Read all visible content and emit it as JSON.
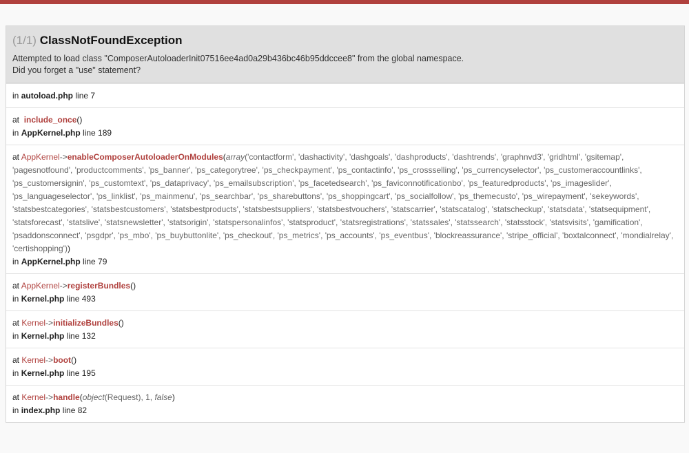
{
  "header": {
    "count": "(1/1)",
    "exception": "ClassNotFoundException",
    "message_line1": "Attempted to load class \"ComposerAutoloaderInit07516ee4ad0a29b436bc46b95ddccee8\" from the global namespace.",
    "message_line2": "Did you forget a \"use\" statement?"
  },
  "frames": [
    {
      "in": "in",
      "file": "autoload.php",
      "line": "line 7"
    },
    {
      "at": "at",
      "fn": "include_once",
      "paren_open": "(",
      "paren_close": ")",
      "in": "in",
      "file": "AppKernel.php",
      "line": "line 189"
    },
    {
      "at": "at",
      "cls": "AppKernel",
      "arrow": "->",
      "fn": "enableComposerAutoloaderOnModules",
      "paren_open": "(",
      "arg_type": "array",
      "args": "('contactform', 'dashactivity', 'dashgoals', 'dashproducts', 'dashtrends', 'graphnvd3', 'gridhtml', 'gsitemap', 'pagesnotfound', 'productcomments', 'ps_banner', 'ps_categorytree', 'ps_checkpayment', 'ps_contactinfo', 'ps_crossselling', 'ps_currencyselector', 'ps_customeraccountlinks', 'ps_customersignin', 'ps_customtext', 'ps_dataprivacy', 'ps_emailsubscription', 'ps_facetedsearch', 'ps_faviconnotificationbo', 'ps_featuredproducts', 'ps_imageslider', 'ps_languageselector', 'ps_linklist', 'ps_mainmenu', 'ps_searchbar', 'ps_sharebuttons', 'ps_shoppingcart', 'ps_socialfollow', 'ps_themecusto', 'ps_wirepayment', 'sekeywords', 'statsbestcategories', 'statsbestcustomers', 'statsbestproducts', 'statsbestsuppliers', 'statsbestvouchers', 'statscarrier', 'statscatalog', 'statscheckup', 'statsdata', 'statsequipment', 'statsforecast', 'statslive', 'statsnewsletter', 'statsorigin', 'statspersonalinfos', 'statsproduct', 'statsregistrations', 'statssales', 'statssearch', 'statsstock', 'statsvisits', 'gamification', 'psaddonsconnect', 'psgdpr', 'ps_mbo', 'ps_buybuttonlite', 'ps_checkout', 'ps_metrics', 'ps_accounts', 'ps_eventbus', 'blockreassurance', 'stripe_official', 'boxtalconnect', 'mondialrelay', 'certishopping')",
      "paren_close": ")",
      "in": "in",
      "file": "AppKernel.php",
      "line": "line 79"
    },
    {
      "at": "at",
      "cls": "AppKernel",
      "arrow": "->",
      "fn": "registerBundles",
      "paren_open": "(",
      "paren_close": ")",
      "in": "in",
      "file": "Kernel.php",
      "line": "line 493"
    },
    {
      "at": "at",
      "cls": "Kernel",
      "arrow": "->",
      "fn": "initializeBundles",
      "paren_open": "(",
      "paren_close": ")",
      "in": "in",
      "file": "Kernel.php",
      "line": "line 132"
    },
    {
      "at": "at",
      "cls": "Kernel",
      "arrow": "->",
      "fn": "boot",
      "paren_open": "(",
      "paren_close": ")",
      "in": "in",
      "file": "Kernel.php",
      "line": "line 195"
    },
    {
      "at": "at",
      "cls": "Kernel",
      "arrow": "->",
      "fn": "handle",
      "paren_open": "(",
      "arg1_type": "object",
      "arg1": "(Request), 1, ",
      "arg2": "false",
      "paren_close": ")",
      "in": "in",
      "file": "index.php",
      "line": "line 82"
    }
  ]
}
